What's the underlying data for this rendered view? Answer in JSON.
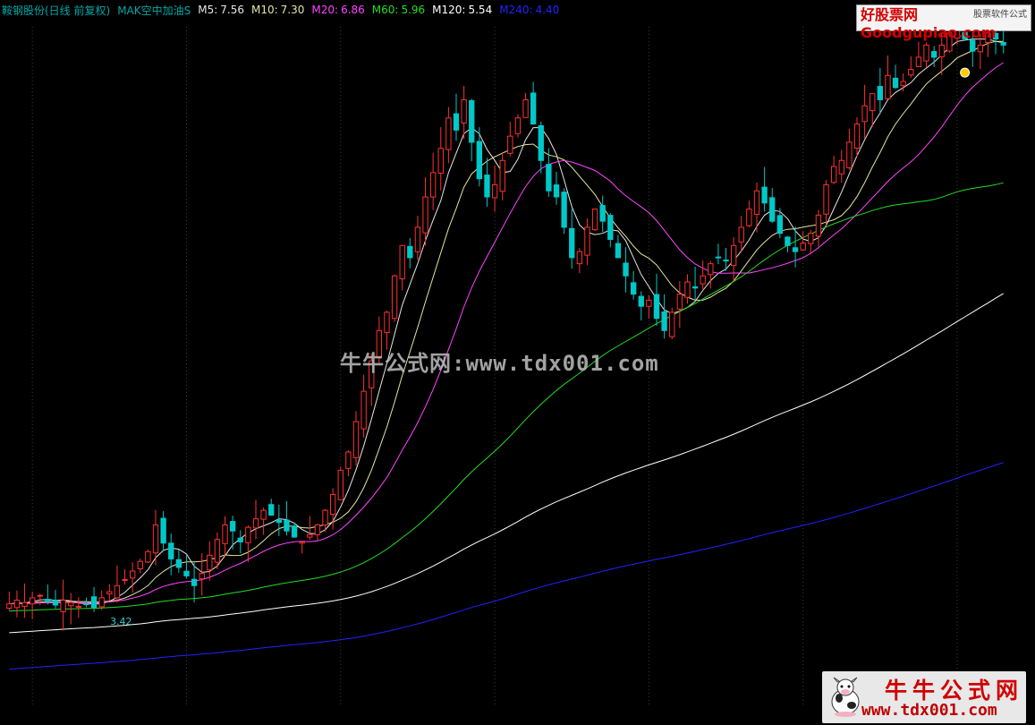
{
  "header": {
    "stock_name": "鞍钢股份(日线 前复权)",
    "indicator_name": "MAK空中加油S",
    "ma_labels": [
      {
        "key": "M5:",
        "value": "7.56",
        "color": "#e6e6e6"
      },
      {
        "key": "M10:",
        "value": "7.30",
        "color": "#e6e6a0"
      },
      {
        "key": "M20:",
        "value": "6.86",
        "color": "#ff44ff"
      },
      {
        "key": "M60:",
        "value": "5.96",
        "color": "#22dd22"
      },
      {
        "key": "M120:",
        "value": "5.54",
        "color": "#ffffff"
      },
      {
        "key": "M240:",
        "value": "4.40",
        "color": "#2222ff"
      }
    ]
  },
  "watermark": {
    "center_text": "牛牛公式网:www.tdx001.com"
  },
  "logo_top": {
    "small_text": "股票软件公式",
    "main_text": "好股票网Goodgupiao.com"
  },
  "logo_bottom": {
    "title": "牛牛公式网",
    "url": "www.tdx001.com"
  },
  "chart_data": {
    "type": "candlestick",
    "title": "",
    "bars": 130,
    "y_range": [
      2.6,
      8.2
    ],
    "low_marker": {
      "value": "3.42",
      "bar": 11
    },
    "signal_marker": {
      "bar": 126,
      "color": "#ffcc00"
    },
    "colors": {
      "up": "#ff3030",
      "down": "#00c8c8",
      "ma5": "#e6e6e6",
      "ma10": "#e6e6a0",
      "ma20": "#ff44ff",
      "ma60": "#22dd22",
      "ma120": "#ffffff",
      "ma240": "#2222ff"
    },
    "close": [
      3.45,
      3.48,
      3.46,
      3.5,
      3.52,
      3.47,
      3.44,
      3.48,
      3.46,
      3.43,
      3.45,
      3.42,
      3.5,
      3.55,
      3.6,
      3.65,
      3.72,
      3.8,
      3.88,
      4.1,
      3.95,
      3.82,
      3.75,
      3.68,
      3.6,
      3.7,
      3.85,
      3.98,
      4.1,
      4.05,
      3.96,
      4.08,
      4.15,
      4.22,
      4.18,
      4.12,
      4.05,
      4.0,
      3.96,
      4.02,
      4.1,
      4.22,
      4.35,
      4.55,
      4.7,
      4.95,
      5.2,
      5.45,
      5.7,
      5.85,
      6.15,
      6.4,
      6.3,
      6.55,
      6.8,
      7.0,
      7.2,
      7.45,
      7.35,
      7.6,
      7.25,
      6.95,
      6.8,
      6.9,
      7.1,
      7.3,
      7.45,
      7.6,
      7.4,
      7.1,
      6.85,
      6.8,
      6.55,
      6.3,
      6.35,
      6.55,
      6.7,
      6.6,
      6.45,
      6.3,
      6.15,
      6.0,
      5.9,
      5.95,
      5.8,
      5.7,
      5.85,
      6.0,
      6.1,
      6.05,
      6.15,
      6.25,
      6.3,
      6.28,
      6.4,
      6.55,
      6.7,
      6.85,
      6.75,
      6.6,
      6.5,
      6.4,
      6.35,
      6.42,
      6.5,
      6.65,
      6.9,
      7.05,
      7.1,
      7.25,
      7.4,
      7.55,
      7.65,
      7.6,
      7.8,
      7.7,
      7.75,
      7.85,
      7.95,
      8.05,
      7.95,
      8.05,
      8.15,
      8.2,
      8.1,
      8.0,
      8.05,
      8.15,
      8.1,
      8.05
    ],
    "y_labels": [],
    "x_labels": []
  }
}
